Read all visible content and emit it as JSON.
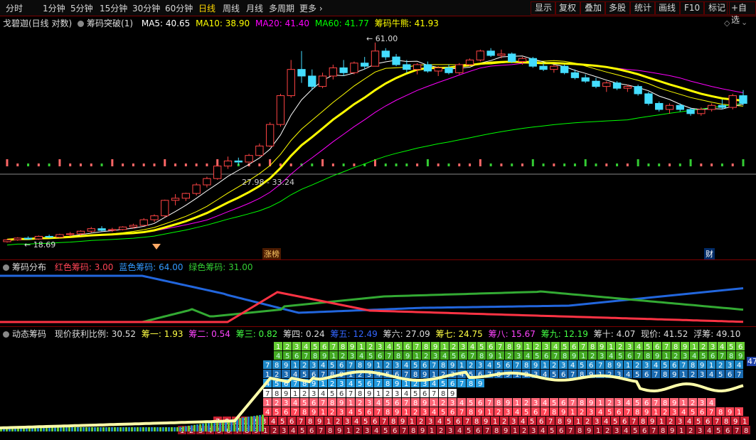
{
  "toolbar": {
    "periods": [
      "分时",
      "1分钟",
      "5分钟",
      "15分钟",
      "30分钟",
      "60分钟",
      "日线",
      "周线",
      "月线",
      "多周期"
    ],
    "active_period": "日线",
    "more_label": "更多",
    "more_icon": "chevron-right-icon",
    "right_buttons": [
      "显示",
      "复权",
      "叠加",
      "多股",
      "统计",
      "画线",
      "F10",
      "标记",
      "+自选"
    ]
  },
  "main_info": {
    "stock": "戈碧迦(日线 对数)",
    "indicator": "筹码突破(1)",
    "ma5": "MA5: 40.65",
    "ma10": "MA10: 38.90",
    "ma20": "MA20: 41.40",
    "ma60": "MA60: 41.77",
    "bull": "筹码牛熊: 41.93",
    "high_label": "61.00",
    "low_label": "18.69",
    "range_label": "27.98 - 33.24",
    "zt_badge": "涨榜",
    "cai_badge": "财",
    "colors": {
      "ma5": "#ffffff",
      "ma10": "#ffff00",
      "ma20": "#ff00ff",
      "ma60": "#00ff00",
      "bull": "#ffff00"
    }
  },
  "chip_info": {
    "title": "筹码分布",
    "red": "红色筹码: 3.00",
    "blue": "蓝色筹码: 64.00",
    "green": "绿色筹码: 31.00"
  },
  "dyn_info": {
    "title": "动态筹码",
    "profit": "现价获利比例: 30.52",
    "c1": "筹一: 1.93",
    "c2": "筹二: 0.54",
    "c3": "筹三: 0.82",
    "c4": "筹四: 0.24",
    "c5": "筹五: 12.49",
    "c6": "筹六: 27.09",
    "c7": "筹七: 24.75",
    "c8": "筹八: 15.67",
    "c9": "筹九: 12.19",
    "c10": "筹十: 4.07",
    "price": "现价: 41.52",
    "float": "浮筹: 49.10",
    "right_badge": "47"
  },
  "chart_data": {
    "type": "candlestick",
    "candles": [
      [
        18.7,
        19.0,
        18.6,
        18.9
      ],
      [
        18.9,
        19.2,
        18.8,
        19.1
      ],
      [
        19.1,
        19.3,
        18.9,
        19.0
      ],
      [
        19.0,
        19.4,
        18.9,
        19.3
      ],
      [
        19.3,
        19.5,
        19.1,
        19.2
      ],
      [
        19.2,
        19.6,
        19.1,
        19.5
      ],
      [
        19.5,
        19.8,
        19.3,
        19.6
      ],
      [
        19.6,
        20.0,
        19.4,
        19.9
      ],
      [
        19.9,
        20.4,
        19.7,
        20.2
      ],
      [
        20.2,
        20.5,
        19.9,
        20.0
      ],
      [
        20.0,
        20.3,
        19.8,
        20.1
      ],
      [
        20.1,
        20.5,
        20.0,
        20.4
      ],
      [
        20.4,
        20.8,
        20.2,
        20.6
      ],
      [
        20.6,
        21.5,
        20.5,
        21.3
      ],
      [
        21.3,
        22.0,
        21.0,
        21.8
      ],
      [
        21.8,
        24.0,
        21.6,
        23.9
      ],
      [
        23.9,
        24.8,
        23.2,
        24.2
      ],
      [
        24.2,
        25.0,
        23.8,
        24.9
      ],
      [
        24.9,
        26.5,
        24.6,
        26.2
      ],
      [
        26.2,
        27.5,
        25.8,
        27.2
      ],
      [
        27.2,
        29.5,
        27.0,
        29.3
      ],
      [
        29.3,
        31.0,
        28.8,
        30.2
      ],
      [
        30.2,
        30.8,
        29.5,
        30.0
      ],
      [
        30.0,
        31.5,
        29.8,
        31.2
      ],
      [
        31.2,
        33.5,
        31.0,
        33.0
      ],
      [
        33.0,
        38.0,
        32.8,
        37.5
      ],
      [
        37.5,
        45.0,
        37.0,
        44.5
      ],
      [
        44.5,
        55.0,
        44.0,
        52.0
      ],
      [
        52.0,
        58.0,
        48.0,
        50.0
      ],
      [
        50.0,
        52.0,
        46.0,
        47.0
      ],
      [
        47.0,
        51.0,
        46.5,
        50.0
      ],
      [
        50.0,
        53.5,
        49.0,
        52.5
      ],
      [
        52.5,
        55.0,
        50.0,
        51.0
      ],
      [
        51.0,
        54.5,
        50.5,
        54.0
      ],
      [
        54.0,
        56.0,
        52.0,
        53.0
      ],
      [
        53.0,
        61.0,
        53.0,
        58.0
      ],
      [
        58.0,
        59.0,
        55.0,
        56.0
      ],
      [
        56.0,
        57.0,
        53.0,
        53.5
      ],
      [
        53.5,
        55.0,
        51.0,
        52.0
      ],
      [
        52.0,
        54.0,
        50.5,
        53.5
      ],
      [
        53.5,
        54.5,
        51.0,
        51.5
      ],
      [
        51.5,
        53.0,
        50.0,
        52.5
      ],
      [
        52.5,
        53.5,
        50.5,
        51.0
      ],
      [
        51.0,
        54.0,
        50.5,
        53.5
      ],
      [
        53.5,
        55.5,
        53.0,
        55.0
      ],
      [
        55.0,
        58.5,
        54.5,
        58.0
      ],
      [
        58.0,
        59.0,
        56.0,
        56.5
      ],
      [
        56.5,
        58.5,
        55.5,
        57.0
      ],
      [
        57.0,
        57.5,
        54.0,
        54.5
      ],
      [
        54.5,
        56.0,
        53.5,
        55.5
      ],
      [
        55.5,
        56.0,
        52.5,
        53.0
      ],
      [
        53.0,
        54.0,
        51.5,
        52.0
      ],
      [
        52.0,
        53.5,
        51.0,
        53.0
      ],
      [
        53.0,
        53.5,
        50.5,
        51.0
      ],
      [
        51.0,
        52.0,
        49.0,
        49.5
      ],
      [
        49.5,
        50.5,
        48.0,
        48.5
      ],
      [
        48.5,
        49.5,
        46.5,
        47.0
      ],
      [
        47.0,
        48.5,
        45.5,
        48.0
      ],
      [
        48.0,
        48.5,
        46.0,
        46.5
      ],
      [
        46.5,
        47.5,
        45.5,
        47.0
      ],
      [
        47.0,
        47.5,
        44.5,
        45.0
      ],
      [
        45.0,
        45.5,
        42.0,
        42.5
      ],
      [
        42.5,
        43.0,
        40.5,
        41.0
      ],
      [
        41.0,
        42.5,
        40.0,
        42.0
      ],
      [
        42.0,
        42.5,
        40.5,
        41.0
      ],
      [
        41.0,
        41.5,
        39.5,
        40.0
      ],
      [
        40.0,
        41.5,
        39.5,
        41.0
      ],
      [
        41.0,
        42.5,
        40.5,
        42.0
      ],
      [
        42.0,
        43.5,
        41.0,
        41.5
      ],
      [
        41.5,
        45.0,
        41.0,
        44.5
      ],
      [
        44.5,
        46.0,
        42.0,
        42.5
      ]
    ],
    "levels": {
      "high": 61.0,
      "low": 18.69,
      "range": [
        27.98,
        33.24
      ]
    }
  }
}
